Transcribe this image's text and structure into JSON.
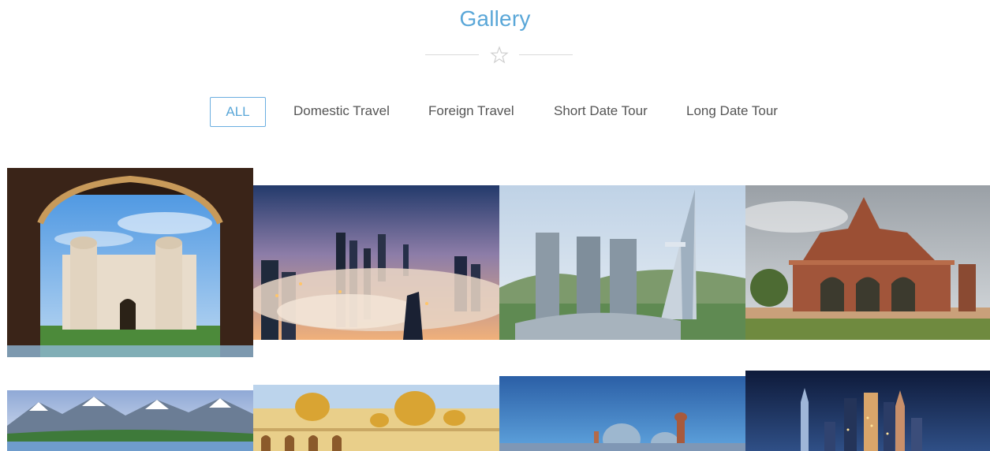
{
  "section": {
    "title": "Gallery"
  },
  "filters": [
    {
      "label": "ALL",
      "active": true
    },
    {
      "label": "Domestic Travel",
      "active": false
    },
    {
      "label": "Foreign Travel",
      "active": false
    },
    {
      "label": "Short Date Tour",
      "active": false
    },
    {
      "label": "Long Date Tour",
      "active": false
    }
  ],
  "gallery": {
    "items": [
      {
        "subject": "fort-through-arch"
      },
      {
        "subject": "city-skyline-in-fog"
      },
      {
        "subject": "modern-towers"
      },
      {
        "subject": "stone-pavilion"
      },
      {
        "subject": "mountain-lake"
      },
      {
        "subject": "golden-domed-palace"
      },
      {
        "subject": "mosque-domes"
      },
      {
        "subject": "night-skyline"
      }
    ]
  },
  "colors": {
    "accent": "#5aa7d8",
    "text": "#555555",
    "divider": "#d9d9d9"
  }
}
